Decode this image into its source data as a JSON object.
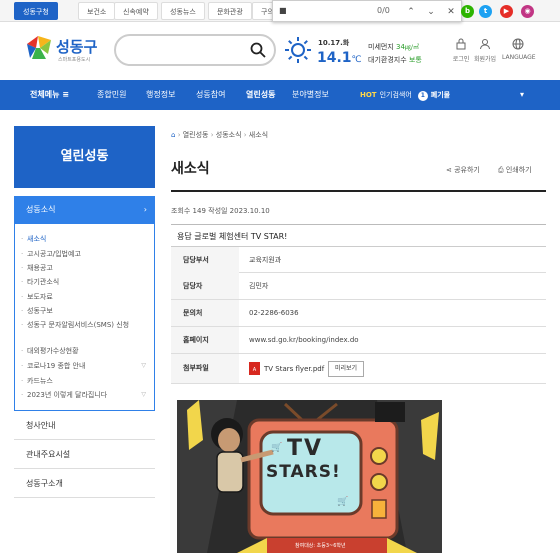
{
  "top_tabs": [
    "성동구청",
    "보건소",
    "신속예약",
    "성동뉴스",
    "문화관광",
    "구의"
  ],
  "find_bar": {
    "query": "■",
    "count": "0/0"
  },
  "sns": [
    {
      "name": "blog",
      "letter": "b",
      "color": "#2db400"
    },
    {
      "name": "twitter",
      "letter": "t",
      "color": "#1da1f2"
    },
    {
      "name": "youtube",
      "letter": "▶",
      "color": "#e52d27"
    },
    {
      "name": "instagram",
      "letter": "◉",
      "color": "#c13584"
    }
  ],
  "logo": {
    "title": "성동구",
    "subtitle": "스마트포용도시"
  },
  "weather": {
    "date": "10.17.화",
    "temp": "14.1",
    "unit": "℃",
    "dust_label": "미세먼지",
    "dust_value": "34",
    "dust_unit": "㎍/㎥",
    "air_label": "대기환경지수",
    "air_value": "보통"
  },
  "utility": [
    "로그인",
    "회원가입",
    "LANGUAGE"
  ],
  "nav": {
    "all_menu": "전체메뉴 ≡",
    "items": [
      "종합민원",
      "행정정보",
      "성동참여",
      "열린성동",
      "분야별정보"
    ],
    "hot_label": "HOT",
    "hot_text": "인기검색어",
    "hot_rank": "1",
    "hot_keyword": "폐기물"
  },
  "sidebar": {
    "heading": "열린성동",
    "section": "성동소식",
    "items": [
      "새소식",
      "고시공고/입법예고",
      "채용공고",
      "타기관소식",
      "보도자료",
      "성동구보",
      "성동구 문자알림서비스(SMS) 신청",
      "대외평가수상현황",
      "코로나19 종합 안내",
      "카드뉴스",
      "2023년 이렇게 달라집니다"
    ],
    "links": [
      "청사안내",
      "관내주요시설",
      "성동구소개"
    ]
  },
  "breadcrumb": [
    "열린성동",
    "성동소식",
    "새소식"
  ],
  "page_title": "새소식",
  "actions": {
    "share": "공유하기",
    "print": "인쇄하기"
  },
  "meta": "조회수 149 작성일 2023.10.10",
  "post_title": "용답 글로벌 체험센터 TV STAR!",
  "info": {
    "dept_label": "담당부서",
    "dept": "교육지원과",
    "person_label": "담당자",
    "person": "김민자",
    "phone_label": "문의처",
    "phone": "02-2286-6036",
    "home_label": "홈페이지",
    "home": "www.sd.go.kr/booking/index.do",
    "file_label": "첨부파일",
    "file": "TV Stars flyer.pdf",
    "preview": "미리보기"
  },
  "poster": {
    "line1": "TV",
    "line2": "STARS!",
    "footer": "참여대상: 초등3~6학년"
  }
}
